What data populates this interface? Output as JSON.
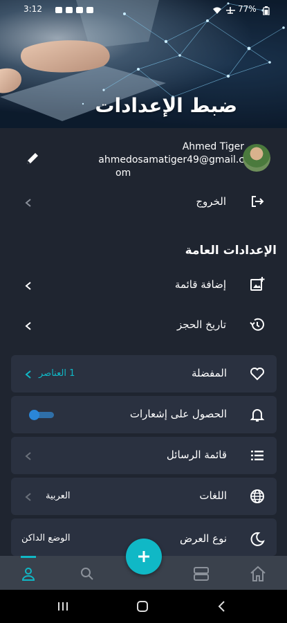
{
  "status_bar": {
    "time": "3:12",
    "battery": "77%"
  },
  "header": {
    "title": "ضبط الإعدادات"
  },
  "profile": {
    "name": "Ahmed Tiger",
    "email_line1": "ahmedosamatiger49@gmail.c",
    "email_line2": "om"
  },
  "logout": {
    "label": "الخروج"
  },
  "general": {
    "title": "الإعدادات العامة",
    "add_list": "إضافة قائمة",
    "booking_history": "تاريخ الحجز"
  },
  "cards": {
    "favorites": {
      "label": "المفضلة",
      "meta": "1 العناصر"
    },
    "notifications": {
      "label": "الحصول على إشعارات"
    },
    "messages": {
      "label": "قائمة الرسائل"
    },
    "languages": {
      "label": "اللغات",
      "meta": "العربية"
    },
    "display": {
      "label": "نوع العرض",
      "meta": "الوضع الداكن"
    }
  },
  "colors": {
    "accent": "#10b8c6",
    "background": "#1f2530",
    "card": "#2a3140",
    "nav": "#3a414c"
  },
  "notifications_toggle_on": true
}
